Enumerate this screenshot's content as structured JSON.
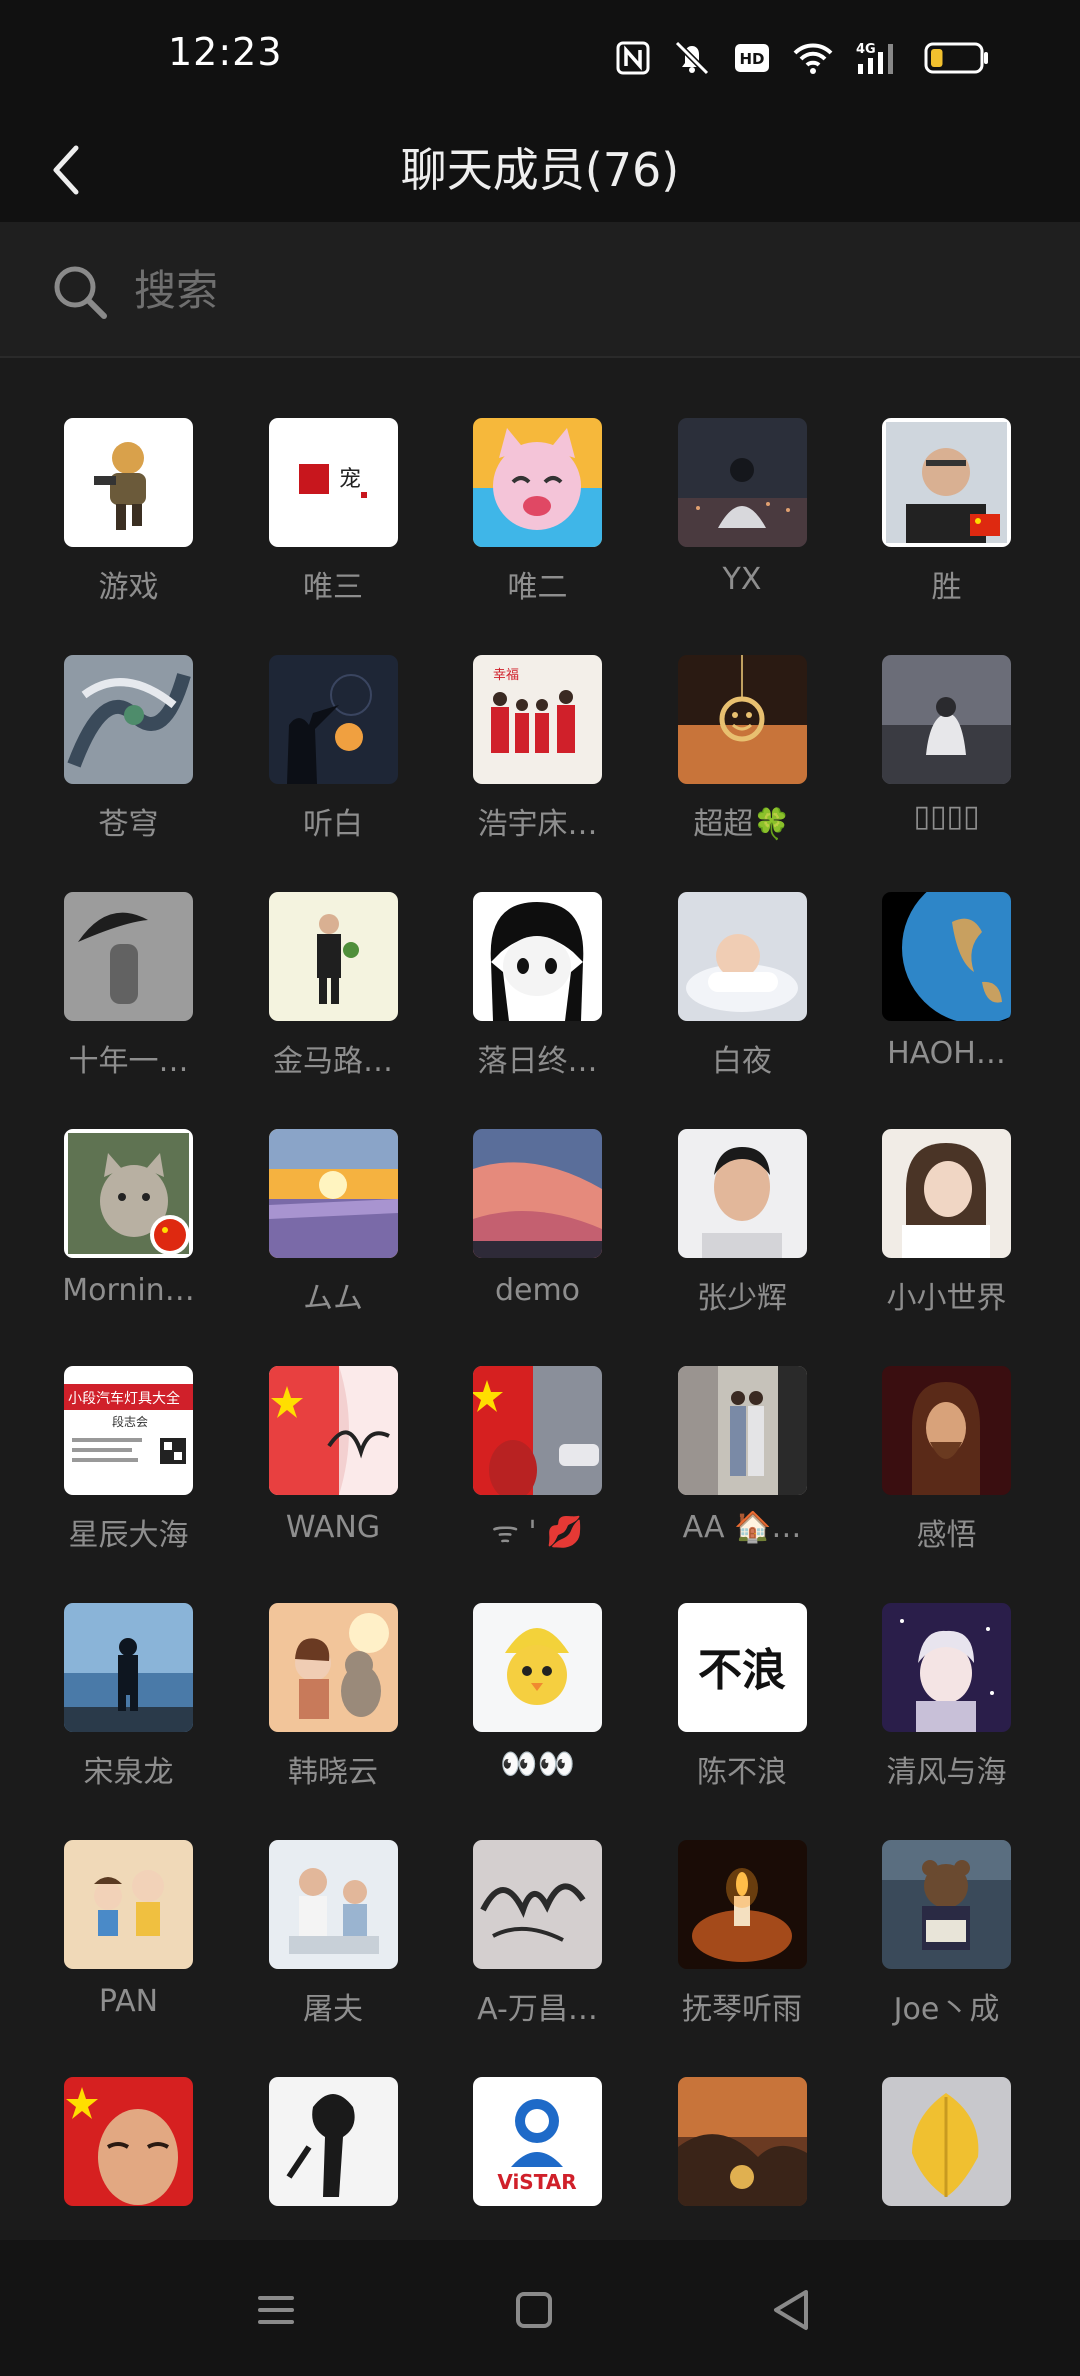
{
  "status_bar": {
    "time": "12:23",
    "icons": [
      "nfc-icon",
      "mute-icon",
      "hd-icon",
      "wifi-icon",
      "signal-4g-icon",
      "battery-icon"
    ],
    "signal_label": "4G",
    "hd_label": "HD",
    "battery_level": 0.25
  },
  "header": {
    "title": "聊天成员(76)",
    "back_icon": "chevron-left-icon"
  },
  "search": {
    "placeholder": "搜索",
    "value": ""
  },
  "colors": {
    "background": "#1b1b1b",
    "header": "#111111",
    "name_text": "#8e8e8e",
    "accent_battery": "#f2c12e"
  },
  "members": [
    {
      "name": "游戏",
      "avatar": "game-character"
    },
    {
      "name": "唯三",
      "avatar": "red-seal-logo"
    },
    {
      "name": "唯二",
      "avatar": "cartoon-cat"
    },
    {
      "name": "YX",
      "avatar": "person-night-city"
    },
    {
      "name": "胜",
      "avatar": "man-portrait-flag"
    },
    {
      "name": "苍穹",
      "avatar": "dragon-art"
    },
    {
      "name": "听白",
      "avatar": "silhouette-moon"
    },
    {
      "name": "浩宇床…",
      "avatar": "family-red"
    },
    {
      "name": "超超🍀",
      "avatar": "smiley-pendant"
    },
    {
      "name": "▯▯▯▯",
      "avatar": "person-rooftop"
    },
    {
      "name": "十年一…",
      "avatar": "umbrella-fog"
    },
    {
      "name": "金马路…",
      "avatar": "man-suit-flower"
    },
    {
      "name": "落日终…",
      "avatar": "anime-girl-bw"
    },
    {
      "name": "白夜",
      "avatar": "sleeping-baby"
    },
    {
      "name": "HAOH…",
      "avatar": "earth-globe"
    },
    {
      "name": "Mornin…",
      "avatar": "cat-flag"
    },
    {
      "name": "ムム",
      "avatar": "lavender-sunset"
    },
    {
      "name": "demo",
      "avatar": "pink-sky"
    },
    {
      "name": "张少辉",
      "avatar": "man-selfie"
    },
    {
      "name": "小小世界",
      "avatar": "woman-portrait"
    },
    {
      "name": "星辰大海",
      "avatar": "business-card"
    },
    {
      "name": "WANG",
      "avatar": "flag-signature"
    },
    {
      "name": "ᯤ ' 💋",
      "avatar": "flag-street"
    },
    {
      "name": "AA 🏠…",
      "avatar": "couple-street"
    },
    {
      "name": "感悟",
      "avatar": "jesus-painting"
    },
    {
      "name": "宋泉龙",
      "avatar": "silhouette-sea"
    },
    {
      "name": "韩晓云",
      "avatar": "girl-cat-sunset"
    },
    {
      "name": "👀👀",
      "avatar": "yellow-chick"
    },
    {
      "name": "陈不浪",
      "avatar": "text-bulang"
    },
    {
      "name": "清风与海",
      "avatar": "anime-boy-space"
    },
    {
      "name": "PAN",
      "avatar": "cartoon-kids"
    },
    {
      "name": "屠夫",
      "avatar": "father-kids"
    },
    {
      "name": "A-万昌…",
      "avatar": "calligraphy"
    },
    {
      "name": "抚琴听雨",
      "avatar": "candle-hands"
    },
    {
      "name": "Joe丶成",
      "avatar": "bear-reading"
    },
    {
      "name": "",
      "avatar": "flag-face"
    },
    {
      "name": "",
      "avatar": "sketch-figure"
    },
    {
      "name": "",
      "avatar": "vistar-logo"
    },
    {
      "name": "",
      "avatar": "game-landscape"
    },
    {
      "name": "",
      "avatar": "yellow-leaf"
    }
  ],
  "texts": {
    "vistar": "ViSTAR",
    "bulang": "不浪",
    "card_line": "小段汽车灯具大全",
    "card_name": "段志会"
  },
  "nav_bar": {
    "menu_icon": "menu-icon",
    "home_icon": "home-square-icon",
    "back_icon": "back-triangle-icon"
  }
}
